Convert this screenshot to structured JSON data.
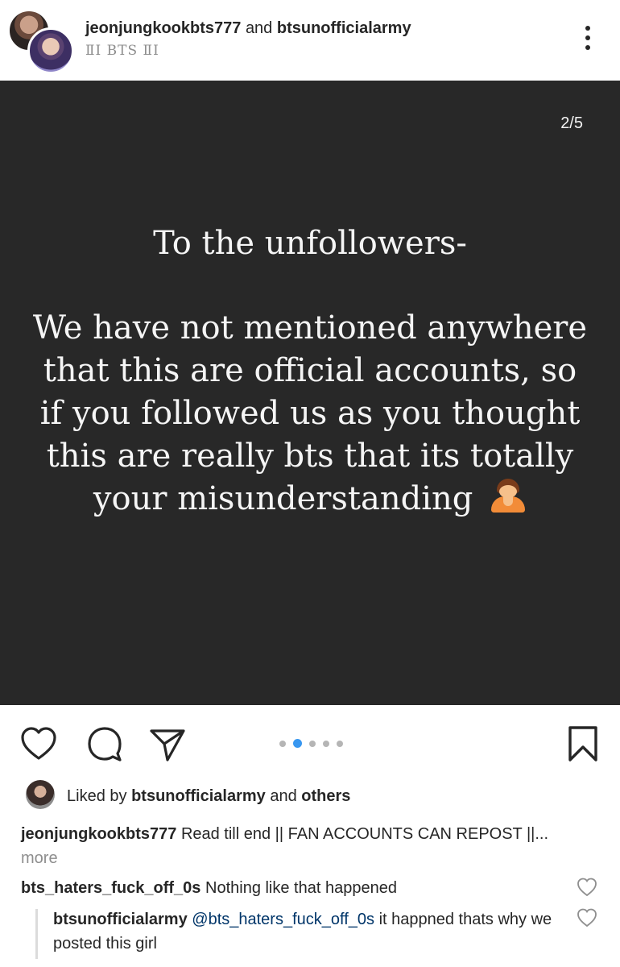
{
  "header": {
    "owner_1": "jeonjungkookbts777",
    "conjunction": "and",
    "owner_2": "btsunofficialarmy",
    "subtitle": "ⅡⅠ BTS ⅡⅠ"
  },
  "post": {
    "counter": "2/5",
    "slide_heading": "To the unfollowers-",
    "slide_body": "We have not mentioned anywhere that this are official accounts, so if you followed us as you thought this are really bts that its totally your misunderstanding",
    "slide_emoji": "person-bowing-emoji",
    "carousel": {
      "total": 5,
      "active_index": 1
    }
  },
  "actions": {
    "icons": [
      "heart-icon",
      "comment-icon",
      "share-icon",
      "bookmark-icon"
    ]
  },
  "likes": {
    "prefix": "Liked by",
    "user": "btsunofficialarmy",
    "conj": "and",
    "others": "others"
  },
  "caption": {
    "user": "jeonjungkookbts777",
    "text": "Read till end || FAN ACCOUNTS CAN REPOST ||...",
    "more": "more"
  },
  "comments": [
    {
      "user": "bts_haters_fuck_off_0s",
      "text": "Nothing like that happened"
    },
    {
      "user": "btsunofficialarmy",
      "mention": "@bts_haters_fuck_off_0s",
      "text": "it happned thats why we posted this girl"
    }
  ],
  "colors": {
    "post_bg": "#282828",
    "accent": "#3897f0",
    "mention": "#003569",
    "muted": "#8e8e8e"
  }
}
